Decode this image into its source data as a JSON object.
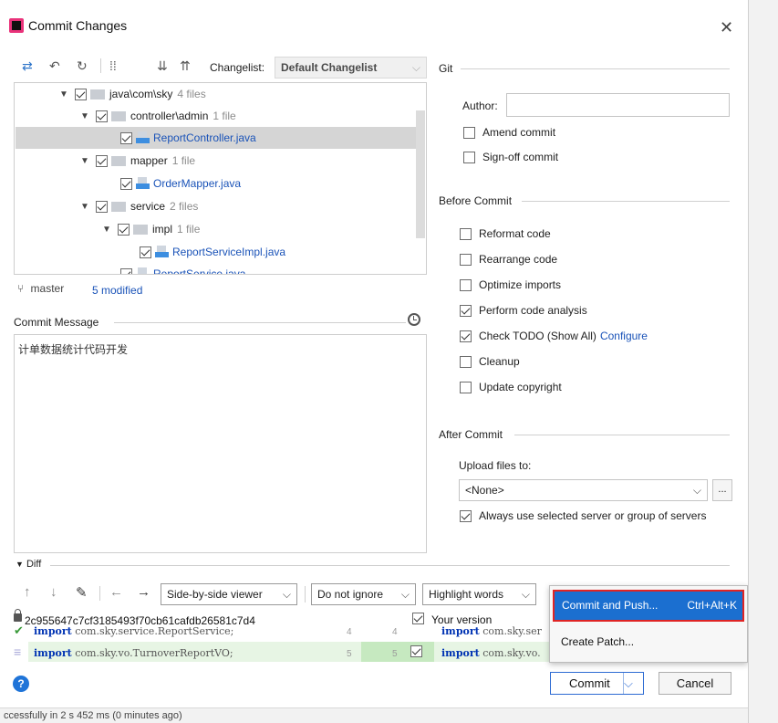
{
  "window": {
    "title": "Commit Changes"
  },
  "toolbar": {
    "changelist_label": "Changelist:",
    "changelist_value": "Default Changelist"
  },
  "tree": {
    "rows": [
      {
        "name": "java\\com\\sky",
        "count": "4 files"
      },
      {
        "name": "controller\\admin",
        "count": "1 file"
      },
      {
        "name": "ReportController.java"
      },
      {
        "name": "mapper",
        "count": "1 file"
      },
      {
        "name": "OrderMapper.java"
      },
      {
        "name": "service",
        "count": "2 files"
      },
      {
        "name": "impl",
        "count": "1 file"
      },
      {
        "name": "ReportServiceImpl.java"
      },
      {
        "name": "ReportService.java"
      }
    ]
  },
  "branch": {
    "name": "master",
    "modified": "5 modified"
  },
  "commit_message": {
    "label": "Commit Message",
    "text": "计单数据统计代码开发"
  },
  "git": {
    "section_label": "Git",
    "author_label": "Author:",
    "author_value": "",
    "amend": "Amend commit",
    "signoff": "Sign-off commit"
  },
  "before_commit": {
    "section_label": "Before Commit",
    "reformat": "Reformat code",
    "rearrange": "Rearrange code",
    "optimize": "Optimize imports",
    "analysis": "Perform code analysis",
    "todo": "Check TODO (Show All)",
    "configure": "Configure",
    "cleanup": "Cleanup",
    "copyright": "Update copyright"
  },
  "after_commit": {
    "section_label": "After Commit",
    "upload_label": "Upload files to:",
    "upload_value": "<None>",
    "dots": "...",
    "always_use": "Always use selected server or group of servers"
  },
  "diff": {
    "label": "Diff",
    "viewer": "Side-by-side viewer",
    "ignore": "Do not ignore",
    "highlight": "Highlight words",
    "hash": "2c955647c7cf3185493f70cb61cafdb26581c7d4",
    "your_version": "Your version",
    "left_line1_kw": "import",
    "left_line1": " com.sky.service.ReportService;",
    "left_line2_kw": "import",
    "left_line2": " com.sky.vo.TurnoverReportVO;",
    "right_line1_kw": "import",
    "right_line1": " com.sky.ser",
    "right_line2_kw": "import",
    "right_line2": " com.sky.vo.",
    "ln1a": "4",
    "ln1b": "4",
    "ln2a": "5",
    "ln2b": "5"
  },
  "popup": {
    "commit_push": "Commit and Push...",
    "shortcut": "Ctrl+Alt+K",
    "patch": "Create Patch..."
  },
  "buttons": {
    "commit": "Commit",
    "cancel": "Cancel",
    "help": "?"
  },
  "status": {
    "text": "ccessfully in 2 s 452 ms (0 minutes ago)"
  }
}
